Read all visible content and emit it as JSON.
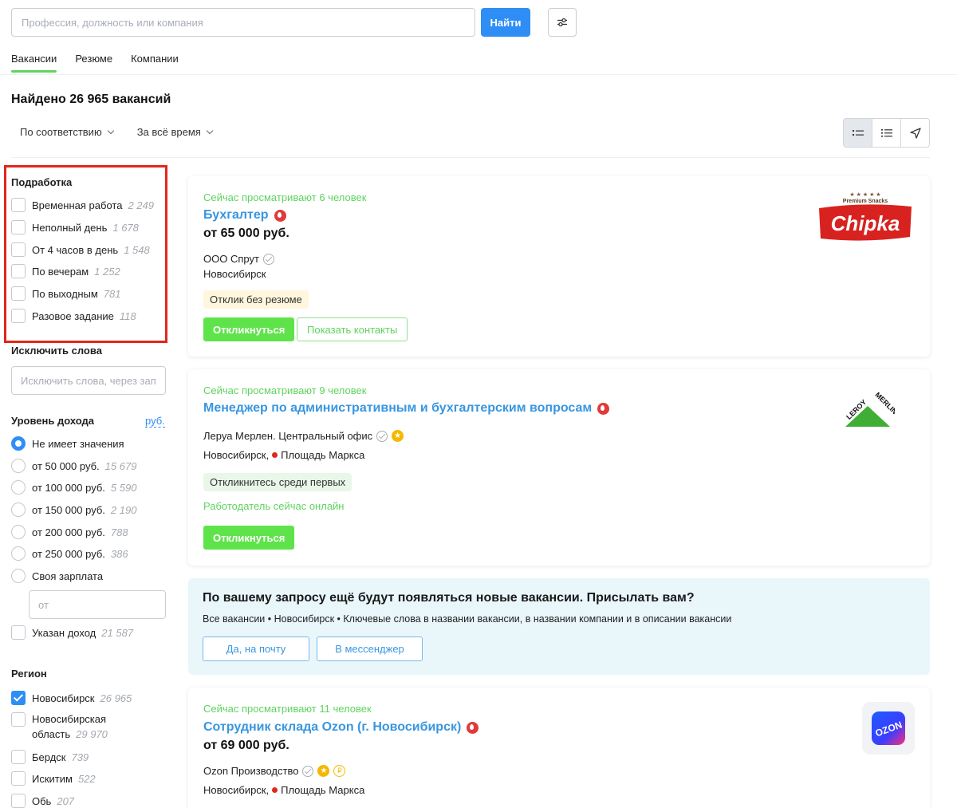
{
  "search": {
    "placeholder": "Профессия, должность или компания",
    "button_label": "Найти"
  },
  "tabs": [
    {
      "label": "Вакансии",
      "active": true
    },
    {
      "label": "Резюме",
      "active": false
    },
    {
      "label": "Компании",
      "active": false
    }
  ],
  "found_text": "Найдено 26 965 вакансий",
  "sort": {
    "relevance": "По соответствию",
    "period": "За всё время"
  },
  "sidebar": {
    "parttime": {
      "title": "Подработка",
      "items": [
        {
          "label": "Временная работа",
          "count": "2 249"
        },
        {
          "label": "Неполный день",
          "count": "1 678"
        },
        {
          "label": "От 4 часов в день",
          "count": "1 548"
        },
        {
          "label": "По вечерам",
          "count": "1 252"
        },
        {
          "label": "По выходным",
          "count": "781"
        },
        {
          "label": "Разовое задание",
          "count": "118"
        }
      ]
    },
    "exclude": {
      "title": "Исключить слова",
      "placeholder": "Исключить слова, через запятую"
    },
    "income": {
      "title": "Уровень дохода",
      "currency_link": "руб.",
      "options": [
        {
          "label": "Не имеет значения",
          "count": "",
          "checked": true
        },
        {
          "label": "от 50 000 руб.",
          "count": "15 679",
          "checked": false
        },
        {
          "label": "от 100 000 руб.",
          "count": "5 590",
          "checked": false
        },
        {
          "label": "от 150 000 руб.",
          "count": "2 190",
          "checked": false
        },
        {
          "label": "от 200 000 руб.",
          "count": "788",
          "checked": false
        },
        {
          "label": "от 250 000 руб.",
          "count": "386",
          "checked": false
        },
        {
          "label": "Своя зарплата",
          "count": "",
          "checked": false
        }
      ],
      "custom_placeholder": "от",
      "specified": {
        "label": "Указан доход",
        "count": "21 587"
      }
    },
    "region": {
      "title": "Регион",
      "items": [
        {
          "label": "Новосибирск",
          "count": "26 965",
          "checked": true
        },
        {
          "label_line1": "Новосибирская",
          "label_line2": "область",
          "count": "29 970",
          "checked": false
        },
        {
          "label": "Бердск",
          "count": "739",
          "checked": false
        },
        {
          "label": "Искитим",
          "count": "522",
          "checked": false
        },
        {
          "label": "Обь",
          "count": "207",
          "checked": false
        }
      ]
    }
  },
  "vacancies": [
    {
      "watching": "Сейчас просматривают 6 человек",
      "title": "Бухгалтер",
      "salary": "от 65 000 руб.",
      "company": "ООО Спрут",
      "city": "Новосибирск",
      "chip": "Отклик без резюме",
      "apply": "Откликнуться",
      "contacts": "Показать контакты",
      "logo_small": "Premium Snacks",
      "logo_text": "Chipka"
    },
    {
      "watching": "Сейчас просматривают 9 человек",
      "title": "Менеджер по административным и бухгалтерским вопросам",
      "company": "Леруа Мерлен. Центральный офис",
      "city": "Новосибирск,",
      "metro": "Площадь Маркса",
      "chip": "Откликнитесь среди первых",
      "online": "Работодатель сейчас онлайн",
      "apply": "Откликнуться",
      "logo_text_a": "LEROY",
      "logo_text_b": "MERLIN"
    },
    {
      "watching": "Сейчас просматривают 11 человек",
      "title": "Сотрудник склада Ozon (г. Новосибирск)",
      "salary": "от 69 000 руб.",
      "company": "Ozon Производство",
      "city": "Новосибирск,",
      "metro": "Площадь Маркса",
      "logo_text": "OZON"
    }
  ],
  "promo": {
    "title": "По вашему запросу ещё будут появляться новые вакансии. Присылать вам?",
    "subtitle": "Все вакансии • Новосибирск • Ключевые слова в названии вакансии, в названии компании и в описании вакансии",
    "email_button": "Да, на почту",
    "messenger_button": "В мессенджер"
  }
}
